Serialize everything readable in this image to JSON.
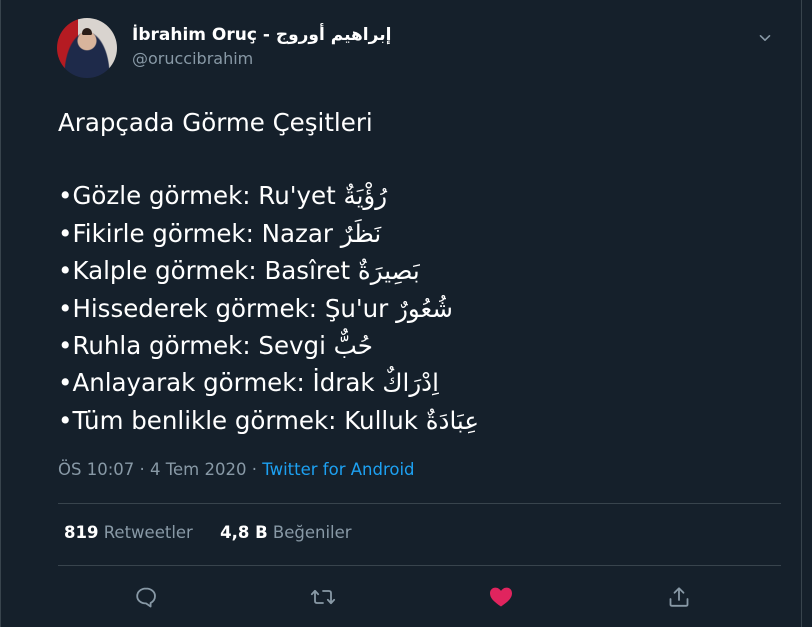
{
  "author": {
    "display_name": "İbrahim Oruç - إبراهيم أوروج",
    "handle": "@oruccibrahim"
  },
  "tweet": {
    "title_line": "Arapçada Görme Çeşitleri",
    "lines": [
      "•Gözle görmek: Ru'yet رُؤْيَةٌ",
      "•Fikirle görmek: Nazar نَظَرٌ",
      "•Kalple görmek: Basîret بَصِيرَةٌ",
      "•Hissederek görmek: Şu'ur شُعُورٌ",
      "•Ruhla görmek: Sevgi حُبٌّ",
      "•Anlayarak görmek: İdrak اِدْرَاكٌ",
      "•Tüm benlikle görmek: Kulluk عِبَادَةٌ"
    ]
  },
  "meta": {
    "time": "ÖS 10:07",
    "date": "4 Tem 2020",
    "separator": " · ",
    "source": "Twitter for Android"
  },
  "stats": {
    "retweets_count": "819",
    "retweets_label": "Retweetler",
    "likes_count": "4,8 B",
    "likes_label": "Beğeniler"
  },
  "colors": {
    "background": "#15202b",
    "muted": "#8899a6",
    "accent": "#1da1f2",
    "like": "#e0245e",
    "divider": "#38444d"
  },
  "icons": {
    "reply": "reply-icon",
    "retweet": "retweet-icon",
    "like": "heart-icon",
    "share": "share-icon",
    "menu": "chevron-down-icon"
  }
}
